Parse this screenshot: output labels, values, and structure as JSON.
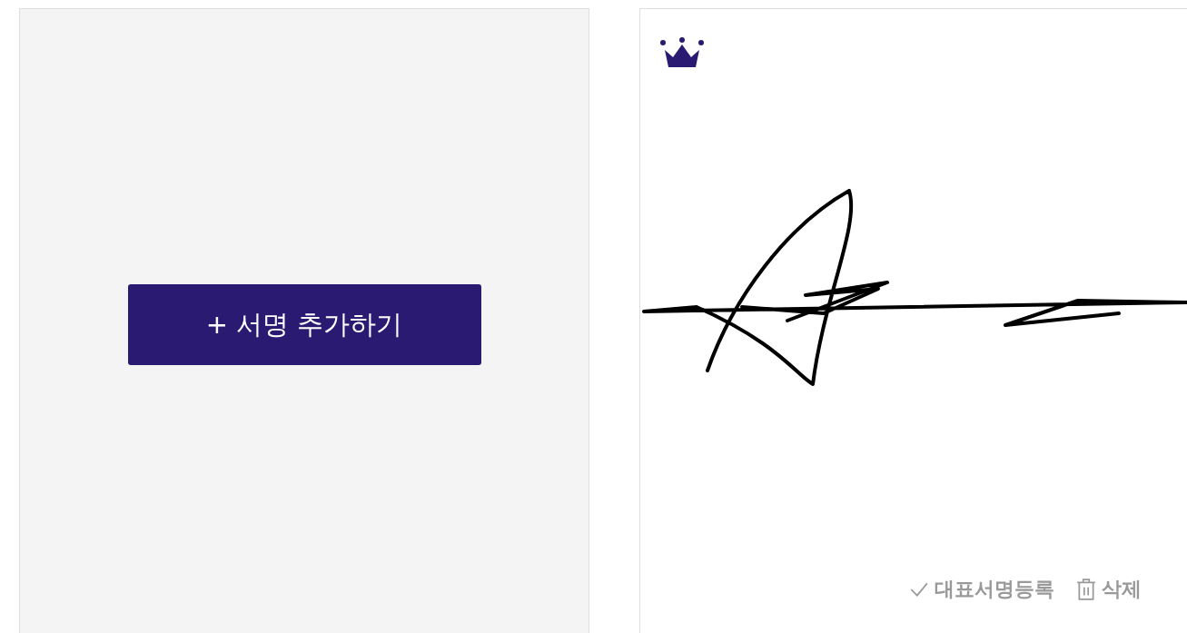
{
  "add_card": {
    "button": "+ 서명 추가하기"
  },
  "signatures": [
    {
      "representative": true,
      "actions": [
        {
          "kind": "check",
          "label": "대표서명등록"
        },
        {
          "kind": "delete",
          "label": "삭제"
        }
      ]
    }
  ]
}
